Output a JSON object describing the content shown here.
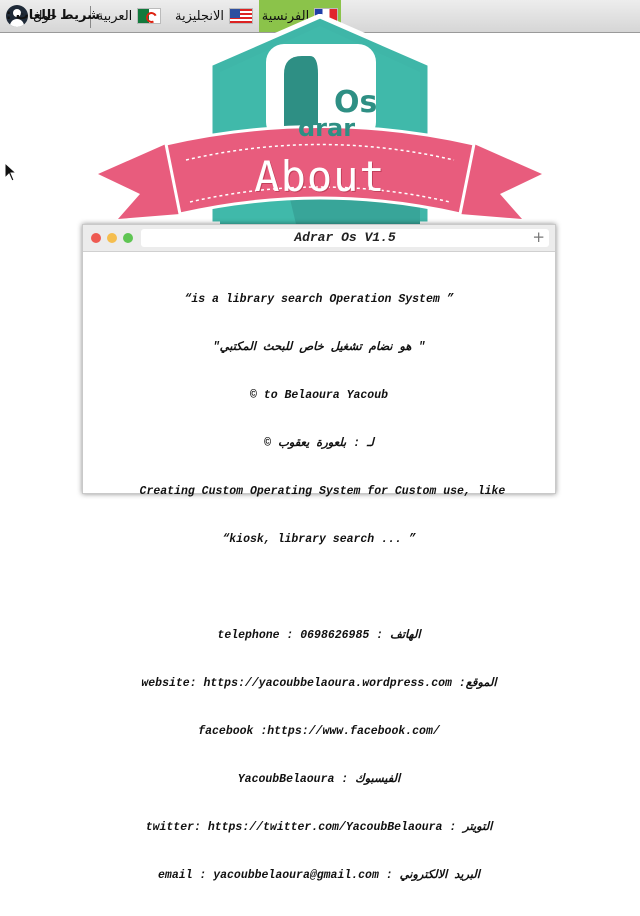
{
  "topbar": {
    "about_label": "حول",
    "languages_label": ": شريط اللغات",
    "lang_arabic": "العربية",
    "lang_english": "الانجليزية",
    "lang_french": "الفرنسية",
    "active_language": "الفرنسية",
    "active_color": "#8bc34a"
  },
  "logo": {
    "os_text": "Os",
    "drar_text": "drar",
    "ribbon_text": "About",
    "colors": {
      "teal": "#3fb6a8",
      "ribbon": "#e85c7d"
    }
  },
  "window": {
    "title": "Adrar Os V1.5",
    "add_tab_symbol": "+",
    "lines": [
      "“is a library search Operation System ”",
      "\"هو نضام تشغيل خاص للبحث المكتبي \"",
      "© to Belaoura Yacoub",
      "© لـ : بلعورة يعقوب",
      " Creating Custom Operating System for Custom use, like",
      "“kiosk, library search ... ”",
      "",
      "telephone : 0698626985 : الهاتف",
      "website: https://yacoubbelaoura.wordpress.com :الموقع",
      "facebook :https://www.facebook.com/",
      "YacoubBelaoura : الفيسبوك",
      "twitter: https://twitter.com/YacoubBelaoura : التويتر",
      "email : yacoubbelaoura@gmail.com : البريد الالكتروني"
    ]
  }
}
